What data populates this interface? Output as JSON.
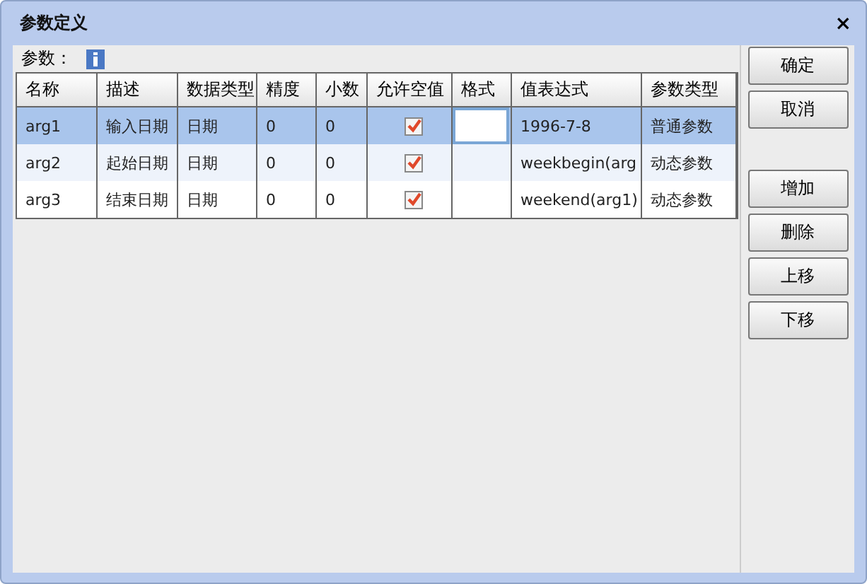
{
  "window": {
    "title": "参数定义",
    "close": "×"
  },
  "params_label": "参数：",
  "table": {
    "columns": [
      "名称",
      "描述",
      "数据类型",
      "精度",
      "小数",
      "允许空值",
      "格式",
      "值表达式",
      "参数类型"
    ],
    "rows": [
      {
        "selected": true,
        "name": "arg1",
        "desc": "输入日期",
        "dtype": "日期",
        "precision": "0",
        "scale": "0",
        "allow_null": true,
        "format_editing": true,
        "expr": "1996-7-8",
        "ptype": "普通参数"
      },
      {
        "selected": false,
        "name": "arg2",
        "desc": "起始日期",
        "dtype": "日期",
        "precision": "0",
        "scale": "0",
        "allow_null": true,
        "format_editing": false,
        "expr": "weekbegin(arg",
        "ptype": "动态参数"
      },
      {
        "selected": false,
        "name": "arg3",
        "desc": "结束日期",
        "dtype": "日期",
        "precision": "0",
        "scale": "0",
        "allow_null": true,
        "format_editing": false,
        "expr": "weekend(arg1)",
        "ptype": "动态参数"
      }
    ]
  },
  "buttons_top": [
    "确定",
    "取消"
  ],
  "buttons_edit": [
    "增加",
    "删除",
    "上移",
    "下移"
  ]
}
